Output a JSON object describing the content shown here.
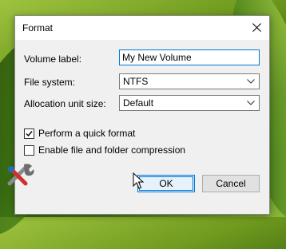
{
  "window": {
    "title": "Format"
  },
  "form": {
    "volume_label": {
      "label": "Volume label:",
      "value": "My New Volume"
    },
    "file_system": {
      "label": "File system:",
      "value": "NTFS"
    },
    "allocation_unit": {
      "label": "Allocation unit size:",
      "value": "Default"
    }
  },
  "options": {
    "quick_format": {
      "label": "Perform a quick format",
      "checked": true
    },
    "compression": {
      "label": "Enable file and folder compression",
      "checked": false
    }
  },
  "buttons": {
    "ok": "OK",
    "cancel": "Cancel"
  },
  "colors": {
    "accent": "#0078d7",
    "dialog_bg": "#f0f0f0"
  }
}
